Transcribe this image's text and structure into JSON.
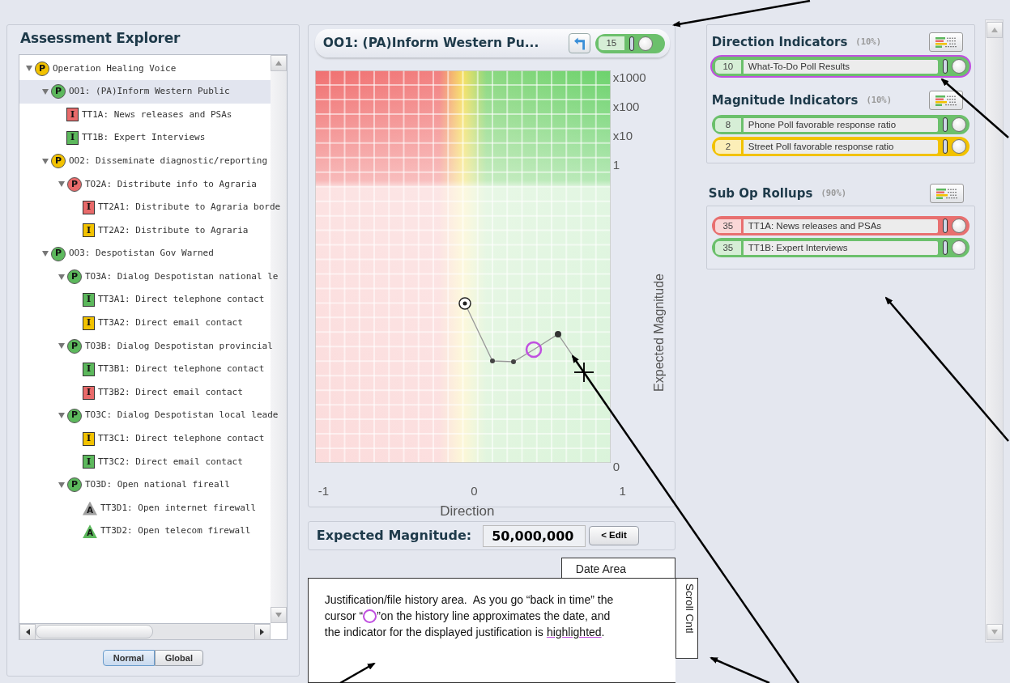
{
  "explorer": {
    "title": "Assessment Explorer",
    "tree": [
      {
        "badge": "P",
        "kind": "circle",
        "color": "#f2c200",
        "label": "Operation Healing Voice",
        "expanded": true,
        "selected": false,
        "children": [
          {
            "badge": "P",
            "kind": "circle",
            "color": "#5cb85c",
            "label": "OO1: (PA)Inform Western Public",
            "expanded": true,
            "selected": true,
            "children": [
              {
                "badge": "I",
                "kind": "square",
                "color": "#e86a6a",
                "label": "TT1A: News releases and PSAs",
                "selected": false
              },
              {
                "badge": "I",
                "kind": "square",
                "color": "#5cb85c",
                "label": "TT1B: Expert Interviews",
                "selected": false
              }
            ]
          },
          {
            "badge": "P",
            "kind": "circle",
            "color": "#f2c200",
            "label": "OO2: Disseminate diagnostic/reporting",
            "expanded": true,
            "selected": false,
            "children": [
              {
                "badge": "P",
                "kind": "circle",
                "color": "#e86a6a",
                "label": "TO2A: Distribute info to Agraria",
                "expanded": true,
                "selected": false,
                "children": [
                  {
                    "badge": "I",
                    "kind": "square",
                    "color": "#e86a6a",
                    "label": "TT2A1: Distribute to Agraria borde",
                    "selected": false
                  },
                  {
                    "badge": "I",
                    "kind": "square",
                    "color": "#f2c200",
                    "label": "TT2A2: Distribute to Agraria",
                    "selected": false
                  }
                ]
              }
            ]
          },
          {
            "badge": "P",
            "kind": "circle",
            "color": "#5cb85c",
            "label": "OO3: Despotistan Gov Warned",
            "expanded": true,
            "selected": false,
            "children": [
              {
                "badge": "P",
                "kind": "circle",
                "color": "#5cb85c",
                "label": "TO3A: Dialog Despotistan national le",
                "expanded": true,
                "selected": false,
                "children": [
                  {
                    "badge": "I",
                    "kind": "square",
                    "color": "#5cb85c",
                    "label": "TT3A1: Direct telephone contact",
                    "selected": false
                  },
                  {
                    "badge": "I",
                    "kind": "square",
                    "color": "#f2c200",
                    "label": "TT3A2: Direct email contact",
                    "selected": false
                  }
                ]
              },
              {
                "badge": "P",
                "kind": "circle",
                "color": "#5cb85c",
                "label": "TO3B: Dialog Despotistan provincial",
                "expanded": true,
                "selected": false,
                "children": [
                  {
                    "badge": "I",
                    "kind": "square",
                    "color": "#5cb85c",
                    "label": "TT3B1: Direct telephone contact",
                    "selected": false
                  },
                  {
                    "badge": "I",
                    "kind": "square",
                    "color": "#e86a6a",
                    "label": "TT3B2: Direct email contact",
                    "selected": false
                  }
                ]
              },
              {
                "badge": "P",
                "kind": "circle",
                "color": "#5cb85c",
                "label": "TO3C: Dialog Despotistan local leade",
                "expanded": true,
                "selected": false,
                "children": [
                  {
                    "badge": "I",
                    "kind": "square",
                    "color": "#f2c200",
                    "label": "TT3C1: Direct telephone contact",
                    "selected": false
                  },
                  {
                    "badge": "I",
                    "kind": "square",
                    "color": "#5cb85c",
                    "label": "TT3C2: Direct email contact",
                    "selected": false
                  }
                ]
              },
              {
                "badge": "P",
                "kind": "circle",
                "color": "#5cb85c",
                "label": "TO3D: Open national fireall",
                "expanded": true,
                "selected": false,
                "children": [
                  {
                    "badge": "A",
                    "kind": "triangle",
                    "color": "#a0a0a0",
                    "label": "TT3D1: Open internet firewall",
                    "selected": false
                  },
                  {
                    "badge": "A",
                    "kind": "triangle",
                    "color": "#5cb85c",
                    "label": "TT3D2: Open telecom firewall",
                    "selected": false
                  }
                ]
              }
            ]
          }
        ]
      }
    ],
    "view_buttons": [
      {
        "label": "Normal",
        "selected": true
      },
      {
        "label": "Global",
        "selected": false
      }
    ]
  },
  "chart_panel": {
    "title": "OO1: (PA)Inform Western Pu...",
    "score": "15",
    "color": "#6cc06c",
    "y_labels": [
      "x1000",
      "x100",
      "x10",
      "1"
    ],
    "y_bottom_label": "0",
    "x_labels": [
      "-1",
      "0",
      "1"
    ],
    "xlabel": "Direction",
    "ylabel": "Expected Magnitude"
  },
  "magnitude": {
    "label": "Expected Magnitude:",
    "value": "50,000,000",
    "button": "< Edit"
  },
  "date_tab": "Date Area",
  "justification": [
    [
      {
        "kind": "text",
        "text": "Justification/file history area.  As you go “back in time” the"
      }
    ],
    [
      {
        "kind": "text",
        "text": "cursor “"
      },
      {
        "kind": "cursor"
      },
      {
        "kind": "text",
        "text": "”on the history line approximates the date, and"
      }
    ],
    [
      {
        "kind": "text",
        "text": "the indicator for the displayed justification is"
      },
      {
        "kind": "highlight",
        "text": "highlighted"
      },
      {
        "kind": "text",
        "text": "."
      }
    ]
  ],
  "scroll_control": "Scroll Cntl",
  "sections": [
    {
      "kind": "inner",
      "title": "Direction Indicators",
      "weight": "(10%)",
      "items": [
        {
          "value": "10",
          "label": "What-To-Do Poll Results",
          "color": "#6cc06c",
          "selected": true
        }
      ]
    },
    {
      "kind": "inner",
      "title": "Magnitude Indicators",
      "weight": "(10%)",
      "items": [
        {
          "value": "8",
          "label": "Phone Poll favorable response ratio",
          "color": "#6cc06c",
          "selected": false
        },
        {
          "value": "2",
          "label": "Street Poll favorable response ratio",
          "color": "#f2c200",
          "selected": false
        }
      ]
    },
    {
      "kind": "outer",
      "title": "Sub Op Rollups",
      "weight": "(90%)",
      "items": [
        {
          "value": "35",
          "label": "TT1A: News releases and PSAs",
          "color": "#e87070",
          "selected": false
        },
        {
          "value": "35",
          "label": "TT1B: Expert Interviews",
          "color": "#6cc06c",
          "selected": false
        }
      ]
    }
  ]
}
